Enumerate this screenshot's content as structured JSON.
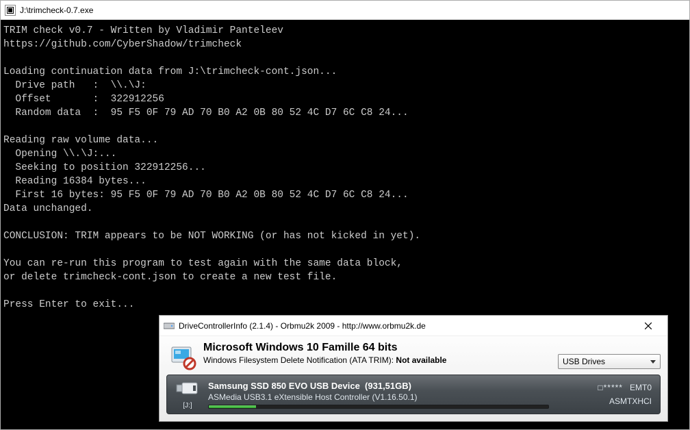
{
  "console": {
    "title": "J:\\trimcheck-0.7.exe",
    "lines": [
      "TRIM check v0.7 - Written by Vladimir Panteleev",
      "https://github.com/CyberShadow/trimcheck",
      "",
      "Loading continuation data from J:\\trimcheck-cont.json...",
      "  Drive path   :  \\\\.\\J:",
      "  Offset       :  322912256",
      "  Random data  :  95 F5 0F 79 AD 70 B0 A2 0B 80 52 4C D7 6C C8 24...",
      "",
      "Reading raw volume data...",
      "  Opening \\\\.\\J:...",
      "  Seeking to position 322912256...",
      "  Reading 16384 bytes...",
      "  First 16 bytes: 95 F5 0F 79 AD 70 B0 A2 0B 80 52 4C D7 6C C8 24...",
      "Data unchanged.",
      "",
      "CONCLUSION: TRIM appears to be NOT WORKING (or has not kicked in yet).",
      "",
      "You can re-run this program to test again with the same data block,",
      "or delete trimcheck-cont.json to create a new test file.",
      "",
      "Press Enter to exit..."
    ]
  },
  "dci": {
    "title": "DriveControllerInfo (2.1.4) - Orbmu2k 2009 - http://www.orbmu2k.de",
    "os_title": "Microsoft Windows 10 Famille 64 bits",
    "trim_label": "Windows Filesystem Delete Notification (ATA TRIM):",
    "trim_status": "Not available",
    "drive_type": "USB Drives",
    "device": {
      "name": "Samsung SSD 850 EVO USB Device",
      "size": "(931,51GB)",
      "controller": "ASMedia USB3.1 eXtensible Host Controller (V1.16.50.1)",
      "drive_letter": "[J:]",
      "smart_stars": "□*****",
      "firmware": "EMT0",
      "driver": "ASMTXHCI",
      "usage_percent": 14
    }
  }
}
